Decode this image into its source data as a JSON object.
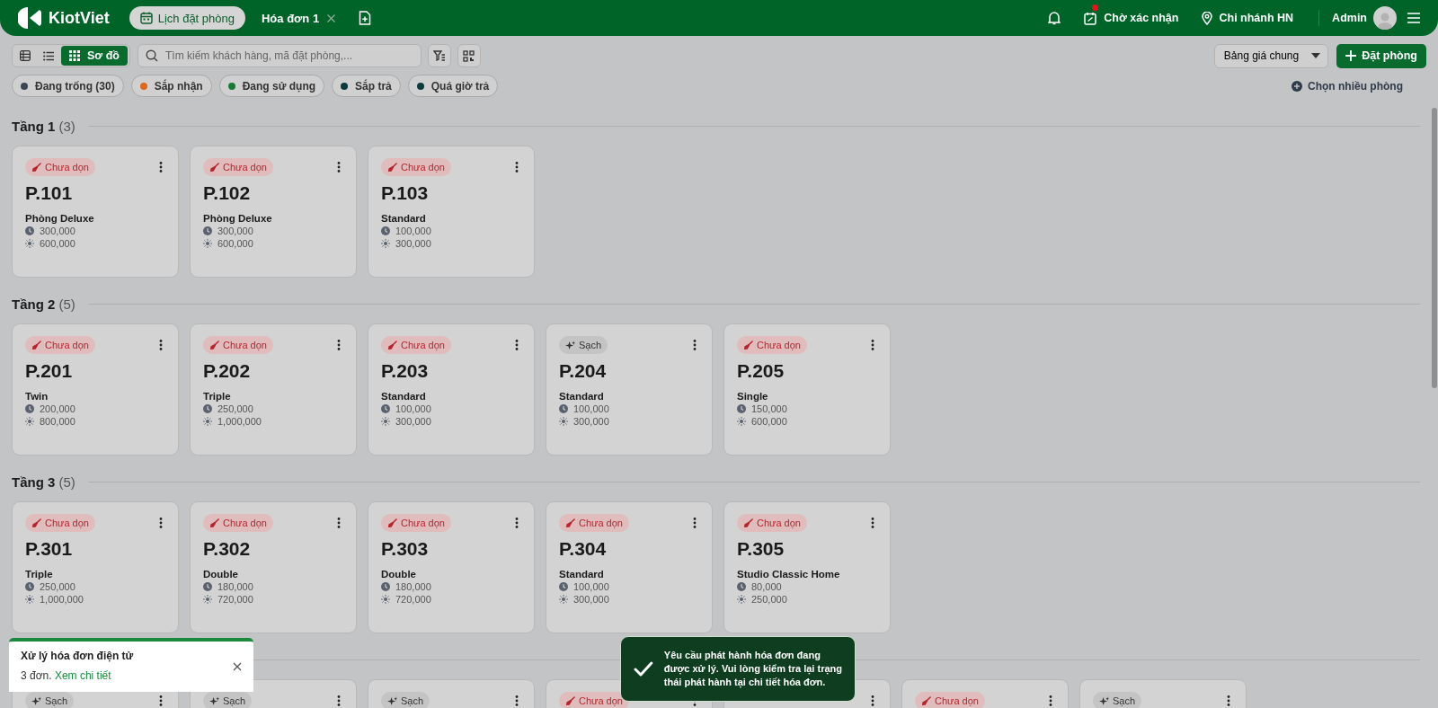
{
  "header": {
    "logo": "KiotViet",
    "tabs": [
      {
        "label": "Lịch đặt phòng",
        "selected": true,
        "closable": false
      },
      {
        "label": "Hóa đơn 1",
        "selected": false,
        "closable": true
      }
    ],
    "pending": "Chờ xác nhận",
    "pending_alert": true,
    "branch": "Chi nhánh HN",
    "user": "Admin"
  },
  "toolbar": {
    "views": [
      {
        "kind": "table",
        "selected": false
      },
      {
        "kind": "list",
        "selected": false
      },
      {
        "kind": "grid",
        "label": "Sơ đồ",
        "selected": true
      }
    ],
    "search": {
      "placeholder": "Tìm kiếm khách hàng, mã đặt phòng,..."
    },
    "price_list": "Bảng giá chung",
    "book_button": "Đặt phòng"
  },
  "status_filters": [
    {
      "label": "Đang trống (30)",
      "color": "#3b4656"
    },
    {
      "label": "Sắp nhận",
      "color": "#e0661c"
    },
    {
      "label": "Đang sử dụng",
      "color": "#1a7a33"
    },
    {
      "label": "Sắp trả",
      "color": "#0d3b3b"
    },
    {
      "label": "Quá giờ trả",
      "color": "#0d3b3b"
    }
  ],
  "multi_select": "Chọn nhiều phòng",
  "floors": [
    {
      "name": "Tầng 1",
      "count": "(3)",
      "rooms": [
        {
          "kind": "dirty",
          "status_label": "Chưa dọn",
          "name": "P.101",
          "type": "Phòng Deluxe",
          "hourly": "300,000",
          "daily": "600,000"
        },
        {
          "kind": "dirty",
          "status_label": "Chưa dọn",
          "name": "P.102",
          "type": "Phòng Deluxe",
          "hourly": "300,000",
          "daily": "600,000"
        },
        {
          "kind": "dirty",
          "status_label": "Chưa dọn",
          "name": "P.103",
          "type": "Standard",
          "hourly": "100,000",
          "daily": "300,000"
        }
      ]
    },
    {
      "name": "Tầng 2",
      "count": "(5)",
      "rooms": [
        {
          "kind": "dirty",
          "status_label": "Chưa dọn",
          "name": "P.201",
          "type": "Twin",
          "hourly": "200,000",
          "daily": "800,000"
        },
        {
          "kind": "dirty",
          "status_label": "Chưa dọn",
          "name": "P.202",
          "type": "Triple",
          "hourly": "250,000",
          "daily": "1,000,000"
        },
        {
          "kind": "dirty",
          "status_label": "Chưa dọn",
          "name": "P.203",
          "type": "Standard",
          "hourly": "100,000",
          "daily": "300,000"
        },
        {
          "kind": "clean",
          "status_label": "Sạch",
          "name": "P.204",
          "type": "Standard",
          "hourly": "100,000",
          "daily": "300,000"
        },
        {
          "kind": "dirty",
          "status_label": "Chưa dọn",
          "name": "P.205",
          "type": "Single",
          "hourly": "150,000",
          "daily": "600,000"
        }
      ]
    },
    {
      "name": "Tầng 3",
      "count": "(5)",
      "rooms": [
        {
          "kind": "dirty",
          "status_label": "Chưa dọn",
          "name": "P.301",
          "type": "Triple",
          "hourly": "250,000",
          "daily": "1,000,000"
        },
        {
          "kind": "dirty",
          "status_label": "Chưa dọn",
          "name": "P.302",
          "type": "Double",
          "hourly": "180,000",
          "daily": "720,000"
        },
        {
          "kind": "dirty",
          "status_label": "Chưa dọn",
          "name": "P.303",
          "type": "Double",
          "hourly": "180,000",
          "daily": "720,000"
        },
        {
          "kind": "dirty",
          "status_label": "Chưa dọn",
          "name": "P.304",
          "type": "Standard",
          "hourly": "100,000",
          "daily": "300,000"
        },
        {
          "kind": "dirty",
          "status_label": "Chưa dọn",
          "name": "P.305",
          "type": "Studio Classic Home",
          "hourly": "80,000",
          "daily": "250,000"
        }
      ]
    },
    {
      "rooms": [
        {
          "kind": "clean",
          "status_label": "Sạch"
        },
        {
          "kind": "clean",
          "status_label": "Sạch"
        },
        {
          "kind": "clean",
          "status_label": "Sạch"
        },
        {
          "kind": "dirty",
          "status_label": "Chưa dọn"
        },
        {
          "kind": "covered"
        },
        {
          "kind": "dirty",
          "status_label": "Chưa dọn"
        },
        {
          "kind": "clean",
          "status_label": "Sạch"
        }
      ]
    }
  ],
  "einvoice_toast": {
    "title": "Xử lý hóa đơn điện tử",
    "body": "3 đơn.",
    "link": "Xem chi tiết"
  },
  "success_toast": {
    "message": "Yêu cầu phát hành hóa đơn đang được xử lý. Vui lòng kiểm tra lại trạng thái phát hành tại chi tiết hóa đơn."
  }
}
